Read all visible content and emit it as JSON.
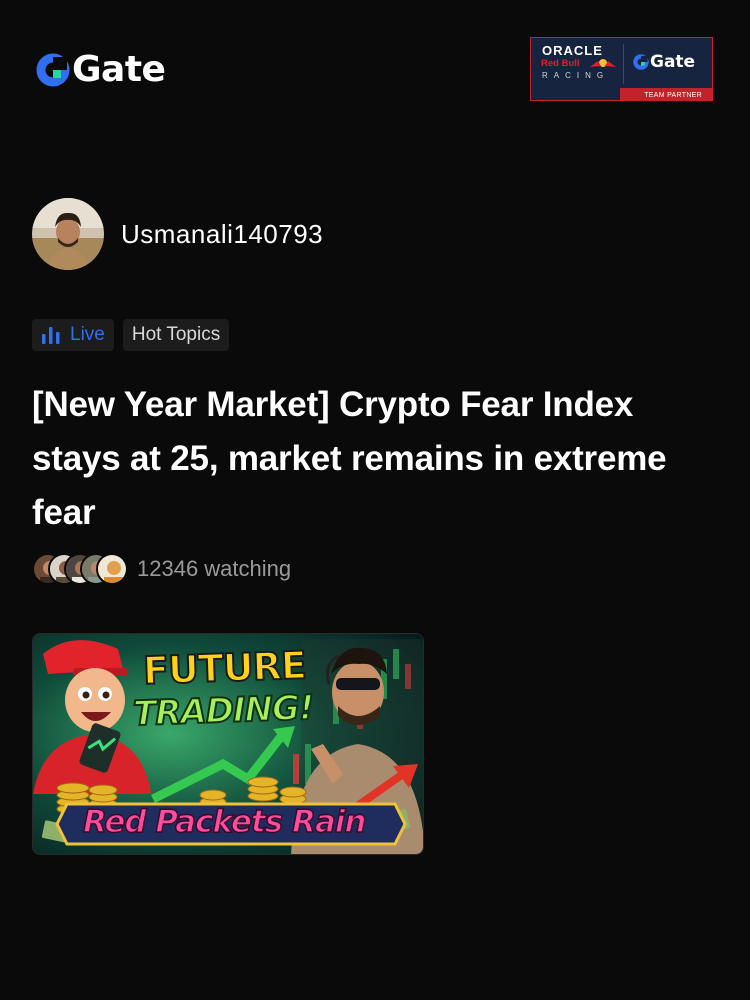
{
  "header": {
    "logo_text": "Gate",
    "brand_color": "#2f6ff0",
    "partner": {
      "line1": "ORACLE",
      "line2": "Red Bull",
      "line3": "RACING",
      "gate_text": "Gate",
      "strip_text": "TEAM PARTNER"
    }
  },
  "author": {
    "name": "Usmanali140793"
  },
  "tags": {
    "live": "Live",
    "hot": "Hot Topics"
  },
  "post": {
    "title": "[New Year Market] Crypto Fear Index stays at 25, market remains in extreme fear"
  },
  "watchers": {
    "count_text": "12346 watching"
  },
  "thumbnail": {
    "headline1": "FUTURE",
    "headline2": "TRADING!",
    "banner": "Red Packets Rain"
  },
  "icons": [
    "gate-logo-icon",
    "live-bars-icon"
  ],
  "colors": {
    "background": "#0a0a0a",
    "live_blue": "#2f6ff0",
    "muted_text": "#9a9a9a",
    "tag_bg": "#1c1c1c"
  }
}
